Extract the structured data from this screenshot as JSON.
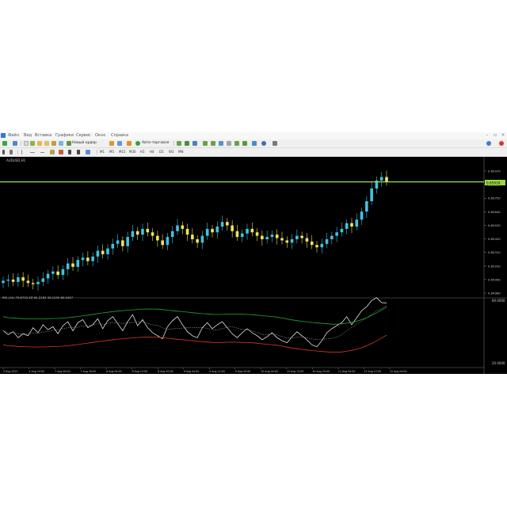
{
  "app": {
    "menu": [
      "Файл",
      "Вид",
      "Вставка",
      "Графики",
      "Сервис",
      "Окно",
      "Справка"
    ],
    "toolbar": {
      "new_order_label": "Новый ордер",
      "autotrade_label": "Авто-торговля",
      "timeframes": [
        "M1",
        "M5",
        "M15",
        "M30",
        "H1",
        "H4",
        "D1",
        "W1",
        "MN"
      ]
    },
    "colors": {
      "background": "#000000",
      "bull": "#3fc3de",
      "bear": "#f2e35a",
      "level_line": "#9ad93a",
      "upper_band": "#1fa63a",
      "lower_band": "#d9342f",
      "rsi_line": "#ffffff"
    }
  },
  "chart": {
    "symbol_label": "AUDUSD,H1",
    "price_axis": [
      "0.65970",
      "0.65860",
      "0.65750",
      "0.65640",
      "0.65530",
      "0.65420",
      "0.65310",
      "0.65200",
      "0.65090",
      "0.64980"
    ],
    "current_price": "0.65918",
    "indicator_label": "RSI (14) 79.6733 ZZ 64.2183 30.1250 80.0457",
    "indicator_axis": [
      "80.0000",
      "20.0000"
    ],
    "time_axis": [
      "3 Aug 2023",
      "4 Aug 20:00",
      "7 Aug 00:00",
      "7 Aug 16:00",
      "8 Aug 04:00",
      "8 Aug 12:00",
      "8 Aug 20:00",
      "9 Aug 04:00",
      "9 Aug 12:00",
      "9 Aug 20:00",
      "10 Aug 04:00",
      "10 Aug 12:00",
      "10 Aug 20:00",
      "11 Aug 04:00",
      "11 Aug 12:00",
      "12 Aug 04:00"
    ]
  },
  "chart_data": {
    "type": "candlestick",
    "series": [
      {
        "name": "AUDUSD,H1",
        "close": [
          0.6506,
          0.6507,
          0.6505,
          0.6509,
          0.6506,
          0.6504,
          0.6503,
          0.6505,
          0.6508,
          0.6512,
          0.6514,
          0.6511,
          0.6516,
          0.6521,
          0.6518,
          0.6524,
          0.6526,
          0.6523,
          0.6527,
          0.6532,
          0.6529,
          0.6534,
          0.6538,
          0.6541,
          0.6536,
          0.6544,
          0.6549,
          0.6546,
          0.6551,
          0.6548,
          0.6545,
          0.6541,
          0.6537,
          0.6544,
          0.6549,
          0.6554,
          0.6551,
          0.6546,
          0.6542,
          0.6539,
          0.6545,
          0.6551,
          0.6548,
          0.6553,
          0.6557,
          0.6554,
          0.6549,
          0.6544,
          0.6547,
          0.6551,
          0.6548,
          0.6545,
          0.6542,
          0.6544,
          0.6546,
          0.6543,
          0.6541,
          0.6539,
          0.6542,
          0.6545,
          0.6543,
          0.654,
          0.6537,
          0.6535,
          0.6538,
          0.6542,
          0.6545,
          0.6548,
          0.6551,
          0.6556,
          0.6553,
          0.6559,
          0.6566,
          0.6575,
          0.6586,
          0.6593,
          0.6596,
          0.6592
        ]
      },
      {
        "name": "RSI (14)",
        "values": [
          52,
          48,
          51,
          45,
          49,
          47,
          55,
          50,
          58,
          53,
          56,
          49,
          57,
          61,
          52,
          60,
          63,
          55,
          58,
          64,
          54,
          62,
          66,
          59,
          52,
          61,
          68,
          57,
          63,
          55,
          50,
          47,
          44,
          56,
          62,
          66,
          58,
          51,
          47,
          45,
          55,
          60,
          54,
          58,
          61,
          55,
          49,
          45,
          50,
          54,
          50,
          47,
          43,
          46,
          50,
          45,
          42,
          40,
          46,
          51,
          47,
          43,
          38,
          36,
          42,
          50,
          54,
          57,
          60,
          66,
          58,
          65,
          72,
          76,
          82,
          85,
          80,
          79.67
        ]
      }
    ],
    "ylim": [
      0.6498,
      0.6597
    ],
    "rsi_range": [
      20,
      80
    ],
    "level": 0.65918
  }
}
